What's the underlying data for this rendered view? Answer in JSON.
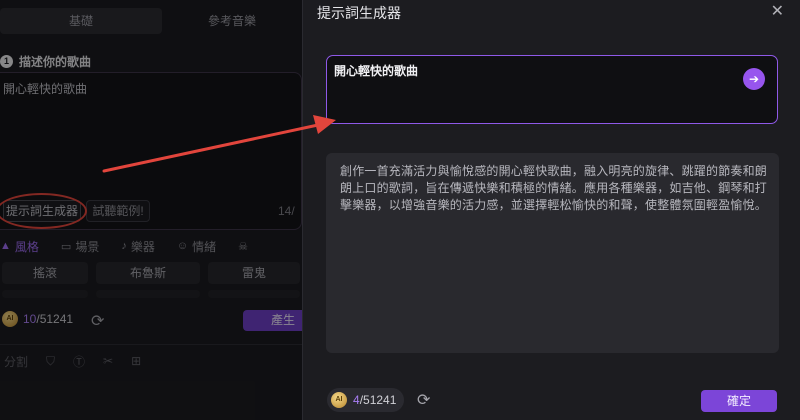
{
  "left": {
    "tabs": [
      "基礎",
      "參考音樂"
    ],
    "step_number": "1",
    "step_label": "描述你的歌曲",
    "description_value": "開心輕快的歌曲",
    "prompt_generator_button": "提示詞生成器",
    "sample_button": "試聽範例!",
    "char_counter": "14/",
    "categories": [
      {
        "icon": "▲",
        "label": "風格"
      },
      {
        "icon": "▭",
        "label": "場景"
      },
      {
        "icon": "♪",
        "label": "樂器"
      },
      {
        "icon": "☺",
        "label": "情緒"
      },
      {
        "icon": "☠",
        "label": ""
      }
    ],
    "tags": [
      "搖滾",
      "布魯斯",
      "雷鬼"
    ],
    "credit_used": "10",
    "credit_total": "/51241",
    "generate_button": "產生",
    "tools": [
      "分割"
    ]
  },
  "modal": {
    "title": "提示詞生成器",
    "close_glyph": "✕",
    "input_value": "開心輕快的歌曲",
    "send_glyph": "➔",
    "result_text": "創作一首充滿活力與愉悅感的開心輕快歌曲，融入明亮的旋律、跳躍的節奏和朗朗上口的歌詞，旨在傳遞快樂和積極的情緒。應用各種樂器，如吉他、鋼琴和打擊樂器，以增強音樂的活力感，並選擇輕松愉快的和聲，使整體氛圍輕盈愉悅。",
    "credit_used": "4",
    "credit_total": "/51241",
    "confirm_button": "確定"
  },
  "colors": {
    "accent": "#8f59e8",
    "annotation": "#e2453c"
  }
}
